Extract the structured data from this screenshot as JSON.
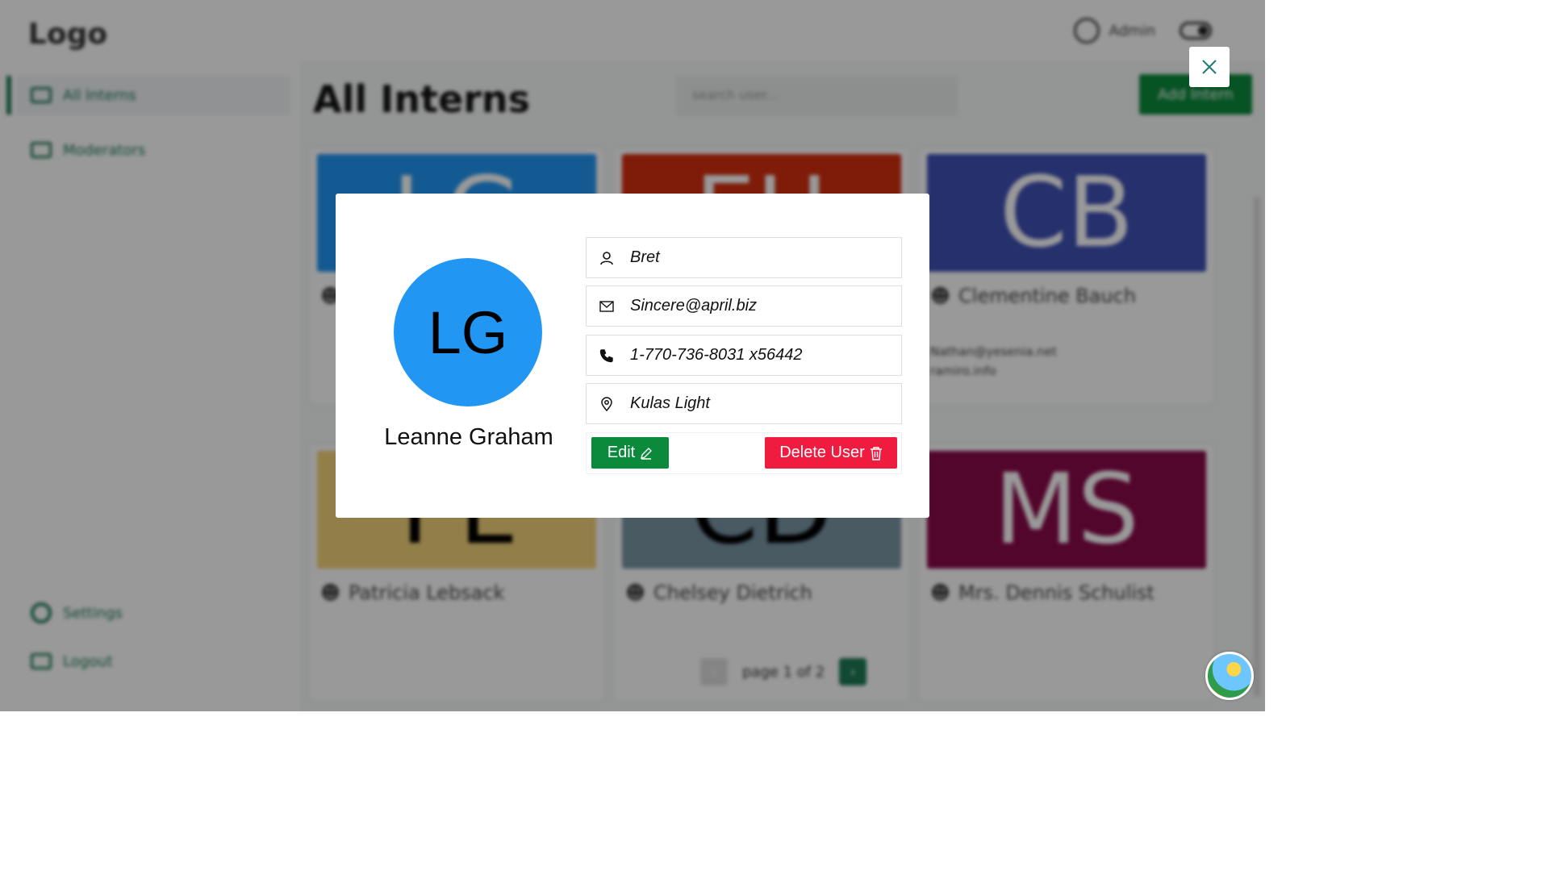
{
  "header": {
    "logo": "Logo",
    "user_label": "Admin"
  },
  "sidebar": {
    "items": [
      {
        "label": "All Interns",
        "icon": "people-icon"
      },
      {
        "label": "Moderators",
        "icon": "id-card-icon"
      }
    ],
    "bottom": [
      {
        "label": "Settings",
        "icon": "gear-icon"
      },
      {
        "label": "Logout",
        "icon": "logout-icon"
      }
    ]
  },
  "main": {
    "title": "All Interns",
    "search_placeholder": "search user...",
    "add_button": "Add Intern",
    "cards": [
      {
        "initials": "LG",
        "color": "#2196f3",
        "name": "",
        "lines": [
          "",
          ""
        ]
      },
      {
        "initials": "EH",
        "color": "#d32f0f",
        "name": "",
        "lines": [
          "",
          ""
        ]
      },
      {
        "initials": "CB",
        "color": "#3f51b5",
        "name": "Clementine Bauch",
        "lines": [
          "Nathan@yesenia.net",
          "ramiro.info"
        ]
      },
      {
        "initials": "PL",
        "color": "#f2d27a",
        "name": "Patricia Lebsack",
        "lines": []
      },
      {
        "initials": "CD",
        "color": "#7a96a6",
        "name": "Chelsey Dietrich",
        "lines": []
      },
      {
        "initials": "MS",
        "color": "#8a0a4a",
        "name": "Mrs. Dennis Schulist",
        "lines": []
      }
    ],
    "pager_text": "page 1 of 2"
  },
  "modal": {
    "initials": "LG",
    "avatar_color": "#2196f3",
    "name": "Leanne Graham",
    "fields": [
      {
        "icon": "user-icon",
        "value": "Bret"
      },
      {
        "icon": "mail-icon",
        "value": "Sincere@april.biz"
      },
      {
        "icon": "phone-icon",
        "value": "1-770-736-8031 x56442"
      },
      {
        "icon": "location-pin-icon",
        "value": "Kulas Light"
      }
    ],
    "edit_label": "Edit",
    "delete_label": "Delete User"
  },
  "colors": {
    "accent_green": "#0b8a3c",
    "danger_red": "#f01c3f",
    "close_icon": "#1d7a75"
  }
}
